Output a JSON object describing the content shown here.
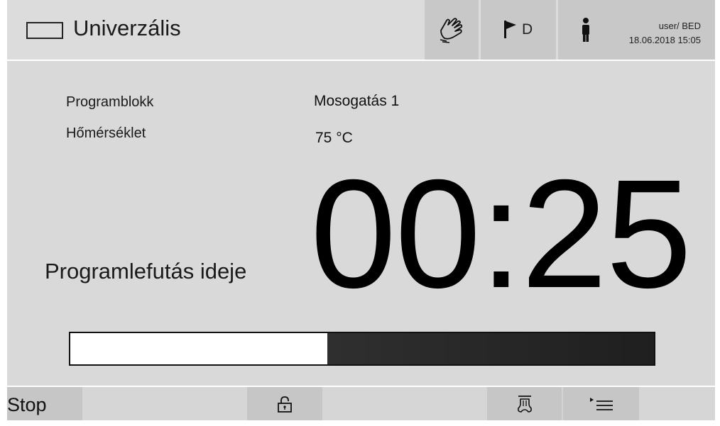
{
  "header": {
    "title": "Univerzális",
    "language": "D",
    "user": "user/ BED",
    "datetime": "18.06.2018 15:05",
    "icons": [
      "program-frame-icon",
      "hand-icon",
      "flag-icon",
      "person-icon"
    ]
  },
  "main": {
    "program_block_label": "Programblokk",
    "program_block_value": "Mosogatás 1",
    "temperature_label": "Hőmérséklet",
    "temperature_value": "75 °C",
    "runtime_label": "Programlefutás ideje",
    "runtime_value": "00:25",
    "progress_fraction": 0.44
  },
  "footer": {
    "stop_label": "Stop",
    "icons": [
      "lock-icon",
      "spray-arm-icon",
      "program-list-icon"
    ]
  },
  "colors": {
    "background": "#d9d9d9",
    "button": "#c8c8c8",
    "progress_track": "#2f2f2f",
    "progress_fill": "#ffffff"
  }
}
